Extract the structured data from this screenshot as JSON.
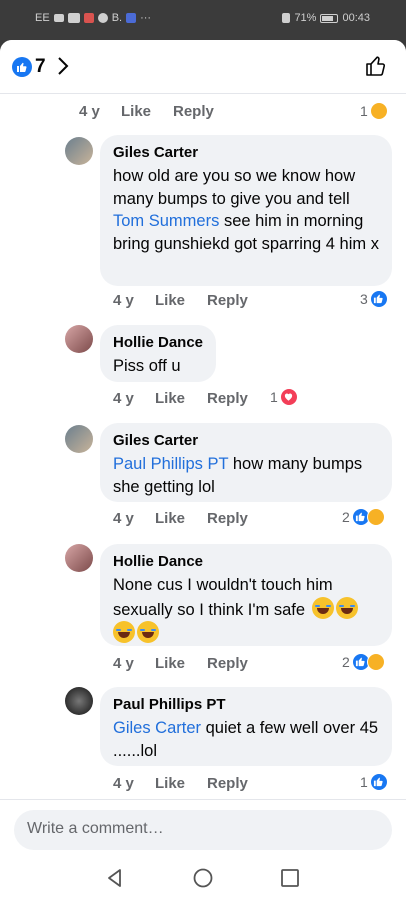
{
  "status_bar": {
    "carrier": "EE",
    "badge_letter": "B.",
    "more": "···",
    "battery_percent": "71%",
    "time": "00:43"
  },
  "header": {
    "reaction_count": "7"
  },
  "top_meta": {
    "age": "4 y",
    "like": "Like",
    "reply": "Reply",
    "reaction_count": "1"
  },
  "comments": [
    {
      "author": "Giles Carter",
      "text_before": "how old are you so we know how many bumps to give you and tell ",
      "mention": "Tom Summers",
      "text_after": " see him in morning bring gunshiekd got sparring 4 him x",
      "age": "4 y",
      "like": "Like",
      "reply": "Reply",
      "reaction_count": "3",
      "reactions": [
        "like"
      ]
    },
    {
      "author": "Hollie Dance",
      "text_before": "Piss off u",
      "age": "4 y",
      "like": "Like",
      "reply": "Reply",
      "reaction_count": "1",
      "reactions": [
        "love"
      ]
    },
    {
      "author": "Giles Carter",
      "mention": "Paul Phillips PT",
      "text_after": " how many bumps she getting lol",
      "age": "4 y",
      "like": "Like",
      "reply": "Reply",
      "reaction_count": "2",
      "reactions": [
        "like",
        "haha"
      ]
    },
    {
      "author": "Hollie Dance",
      "text_before": "None cus I wouldn't touch him sexually so I think I'm safe",
      "emojis": [
        "laughing-crying",
        "laughing-crying",
        "laughing-crying",
        "laughing-crying"
      ],
      "age": "4 y",
      "like": "Like",
      "reply": "Reply",
      "reaction_count": "2",
      "reactions": [
        "like",
        "haha"
      ]
    },
    {
      "author": "Paul Phillips PT",
      "mention": "Giles Carter",
      "text_after": " quiet a few well over 45 ......lol",
      "age": "4 y",
      "like": "Like",
      "reply": "Reply",
      "reaction_count": "1",
      "reactions": [
        "like"
      ]
    }
  ],
  "composer": {
    "placeholder": "Write a comment…"
  },
  "colors": {
    "accent": "#1877f2",
    "mention": "#216fdb",
    "bubble": "#f0f2f5",
    "meta": "#65676b",
    "love": "#f33e58",
    "haha": "#f7b125"
  }
}
